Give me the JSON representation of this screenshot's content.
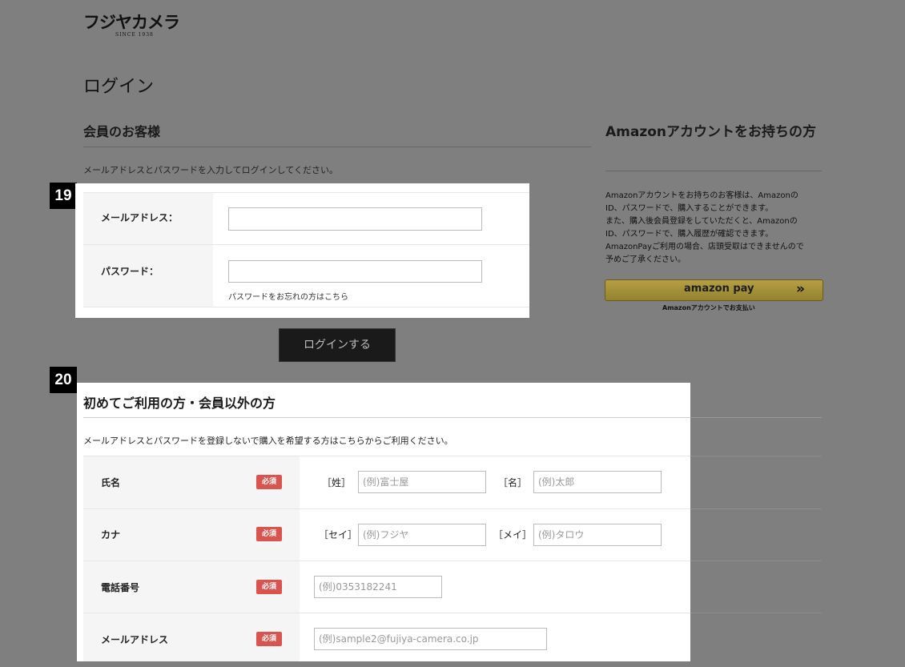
{
  "logo": {
    "text": "フジヤカメラ",
    "since": "SINCE 1938"
  },
  "page_title": "ログイン",
  "member": {
    "title": "会員のお客様",
    "description": "メールアドレスとパスワードを入力してログインしてください。",
    "email_label": "メールアドレス：",
    "password_label": "パスワード：",
    "forgot_link": "パスワードをお忘れの方はこちら",
    "login_button": "ログインする"
  },
  "amazon": {
    "title": "Amazonアカウントをお持ちの方",
    "description": [
      "Amazonアカウントをお持ちのお客様は、Amazonの",
      "ID、パスワードで、購入することができます。",
      "また、購入後会員登録をしていただくと、Amazonの",
      "ID、パスワードで、購入履歴が確認できます。",
      "AmazonPayご利用の場合、店頭受取はできませんので",
      "予めご了承ください。"
    ],
    "button_label": "amazon pay",
    "button_arrow": "»",
    "caption": "Amazonアカウントでお支払い"
  },
  "guest": {
    "title": "初めてご利用の方・会員以外の方",
    "description": "メールアドレスとパスワードを登録しないで購入を希望する方はこちらからご利用ください。",
    "required": "必須",
    "rows": {
      "name": {
        "label": "氏名",
        "prefix1": "［姓］",
        "placeholder1": "(例)富士屋",
        "prefix2": "［名］",
        "placeholder2": "(例)太郎"
      },
      "kana": {
        "label": "カナ",
        "prefix1": "［セイ］",
        "placeholder1": "(例)フジヤ",
        "prefix2": "［メイ］",
        "placeholder2": "(例)タロウ"
      },
      "phone": {
        "label": "電話番号",
        "placeholder": "(例)0353182241"
      },
      "email": {
        "label": "メールアドレス",
        "placeholder": "(例)sample2@fujiya-camera.co.jp"
      }
    }
  },
  "annotations": {
    "badge1": "19",
    "badge2": "20"
  },
  "colors": {
    "overlay": "#7f7f7f",
    "required": "#d9534f",
    "amazon_button": "#b59f43",
    "login_button": "#1a1a1a"
  }
}
